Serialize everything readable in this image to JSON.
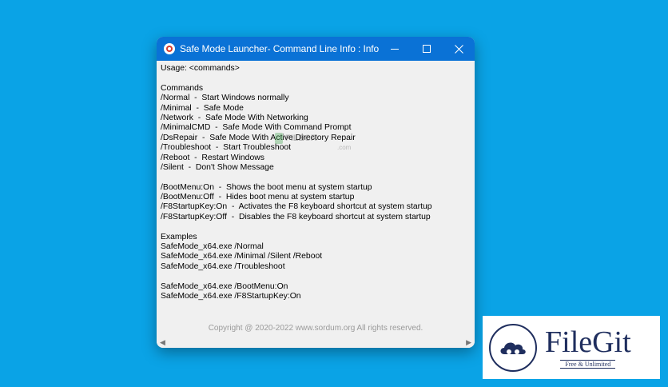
{
  "window": {
    "title": "Safe Mode Launcher- Command Line Info : Info",
    "controls": {
      "minimize": "minimize",
      "maximize": "maximize",
      "close": "×"
    }
  },
  "content": {
    "lines": [
      "Usage: <commands>",
      "",
      "Commands",
      "/Normal  -  Start Windows normally",
      "/Minimal  -  Safe Mode",
      "/Network  -  Safe Mode With Networking",
      "/MinimalCMD  -  Safe Mode With Command Prompt",
      "/DsRepair  -  Safe Mode With Active Directory Repair",
      "/Troubleshoot  -  Start Troubleshoot",
      "/Reboot  -  Restart Windows",
      "/Silent  -  Don't Show Message",
      "",
      "/BootMenu:On  -  Shows the boot menu at system startup",
      "/BootMenu:Off  -  Hides boot menu at system startup",
      "/F8StartupKey:On  -  Activates the F8 keyboard shortcut at system startup",
      "/F8StartupKey:Off  -  Disables the F8 keyboard shortcut at system startup",
      "",
      "Examples",
      "SafeMode_x64.exe /Normal",
      "SafeMode_x64.exe /Minimal /Silent /Reboot",
      "SafeMode_x64.exe /Troubleshoot",
      "",
      "SafeMode_x64.exe /BootMenu:On",
      "SafeMode_x64.exe /F8StartupKey:On"
    ],
    "copyright": "Copyright @ 2020-2022 www.sordum.org All rights reserved."
  },
  "scrollbar": {
    "left_arrow": "◀",
    "right_arrow": "▶"
  },
  "watermark": {
    "text": "FILECR",
    "suffix": ".com"
  },
  "filegit_badge": {
    "brand": "FileGit",
    "tagline": "Free & Unlimited"
  }
}
